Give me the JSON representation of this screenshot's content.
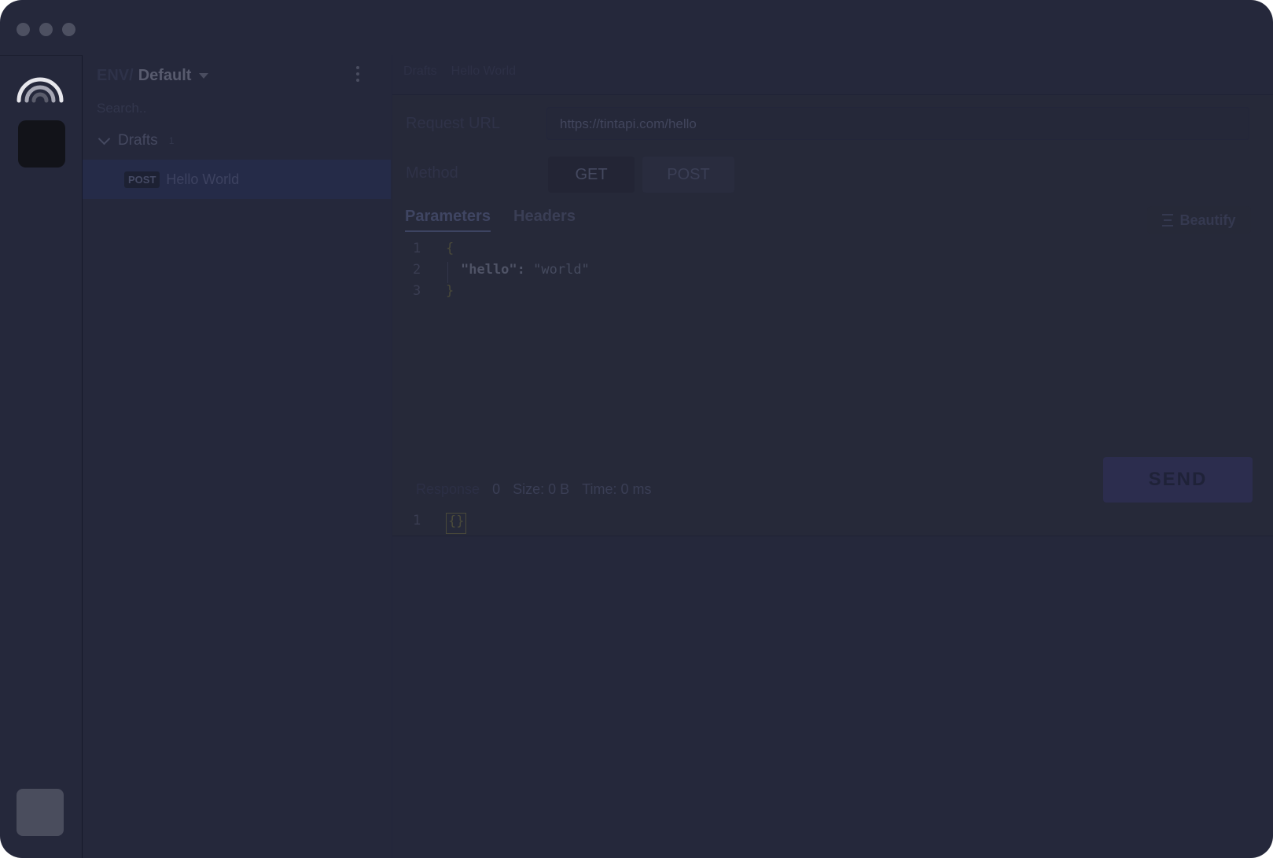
{
  "window": {
    "controls": [
      "close",
      "minimize",
      "maximize"
    ]
  },
  "rail": {
    "logo": "rainbow-logo-icon"
  },
  "sidebar": {
    "env_prefix": "ENV/",
    "env_name": "Default",
    "search_placeholder": "Search..",
    "folder": {
      "name": "Drafts",
      "count": "1"
    },
    "items": [
      {
        "method": "POST",
        "name": "Hello World"
      }
    ]
  },
  "main": {
    "breadcrumb": [
      "Drafts",
      "Hello World"
    ],
    "url_label": "Request URL",
    "url": "https://tintapi.com/hello",
    "method_label": "Method",
    "methods": [
      "GET",
      "POST"
    ],
    "tabs": [
      "Parameters",
      "Headers"
    ],
    "beautify_label": "Beautify",
    "body_lines": [
      {
        "n": "1",
        "text": "{"
      },
      {
        "n": "2",
        "key": "\"hello\"",
        "colon": ": ",
        "value": "\"world\""
      },
      {
        "n": "3",
        "text": "}"
      }
    ],
    "send_label": "SEND"
  },
  "response": {
    "label": "Response",
    "status": "0",
    "size": "Size: 0 B",
    "time": "Time: 0 ms",
    "line": {
      "n": "1",
      "text": "{}"
    }
  }
}
